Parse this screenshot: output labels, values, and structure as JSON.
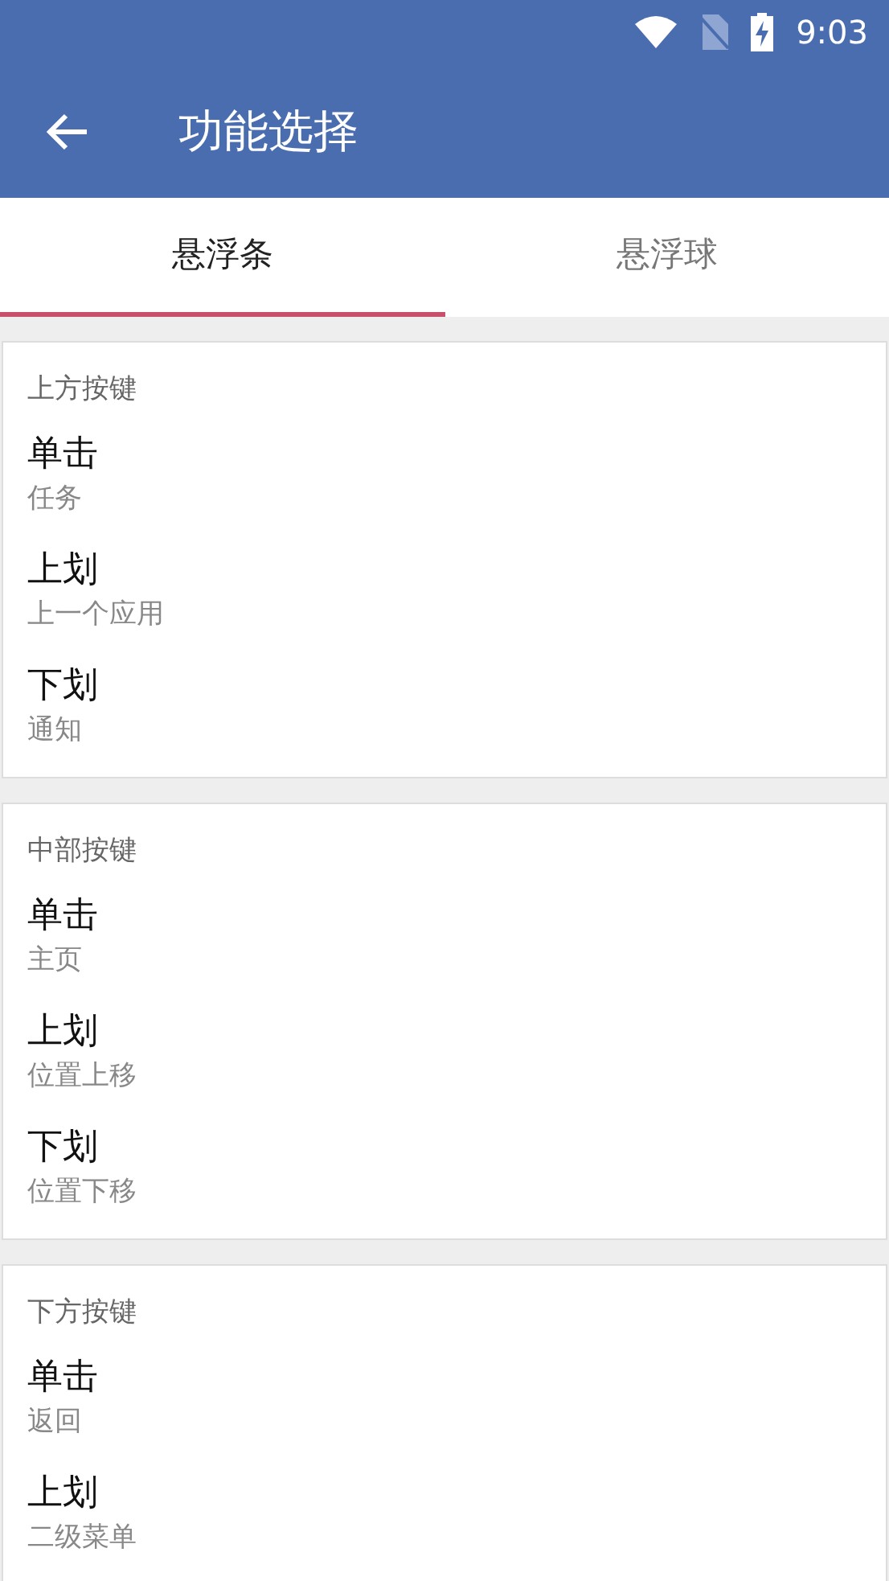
{
  "status_bar": {
    "time": "9:03"
  },
  "app_bar": {
    "title": "功能选择"
  },
  "tabs": [
    {
      "label": "悬浮条",
      "selected": true
    },
    {
      "label": "悬浮球",
      "selected": false
    }
  ],
  "sections": [
    {
      "title": "上方按键",
      "items": [
        {
          "label": "单击",
          "value": "任务"
        },
        {
          "label": "上划",
          "value": "上一个应用"
        },
        {
          "label": "下划",
          "value": "通知"
        }
      ]
    },
    {
      "title": "中部按键",
      "items": [
        {
          "label": "单击",
          "value": "主页"
        },
        {
          "label": "上划",
          "value": "位置上移"
        },
        {
          "label": "下划",
          "value": "位置下移"
        }
      ]
    },
    {
      "title": "下方按键",
      "items": [
        {
          "label": "单击",
          "value": "返回"
        },
        {
          "label": "上划",
          "value": "二级菜单"
        }
      ]
    }
  ]
}
